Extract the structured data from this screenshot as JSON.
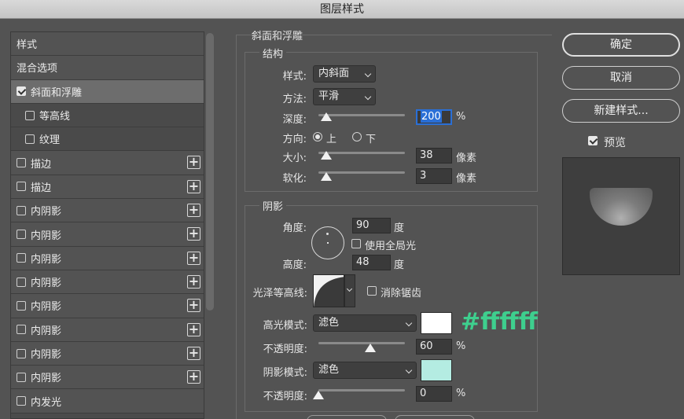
{
  "window": {
    "title": "图层样式"
  },
  "style_list": {
    "header": "样式",
    "blend": "混合选项",
    "items": [
      {
        "label": "斜面和浮雕",
        "checked": true,
        "selected": true,
        "sub": false,
        "plus": false
      },
      {
        "label": "等高线",
        "checked": false,
        "selected": false,
        "sub": true,
        "plus": false
      },
      {
        "label": "纹理",
        "checked": false,
        "selected": false,
        "sub": true,
        "plus": false
      },
      {
        "label": "描边",
        "checked": false,
        "selected": false,
        "sub": false,
        "plus": true
      },
      {
        "label": "描边",
        "checked": false,
        "selected": false,
        "sub": false,
        "plus": true
      },
      {
        "label": "内阴影",
        "checked": false,
        "selected": false,
        "sub": false,
        "plus": true
      },
      {
        "label": "内阴影",
        "checked": false,
        "selected": false,
        "sub": false,
        "plus": true
      },
      {
        "label": "内阴影",
        "checked": false,
        "selected": false,
        "sub": false,
        "plus": true
      },
      {
        "label": "内阴影",
        "checked": false,
        "selected": false,
        "sub": false,
        "plus": true
      },
      {
        "label": "内阴影",
        "checked": false,
        "selected": false,
        "sub": false,
        "plus": true
      },
      {
        "label": "内阴影",
        "checked": false,
        "selected": false,
        "sub": false,
        "plus": true
      },
      {
        "label": "内阴影",
        "checked": false,
        "selected": false,
        "sub": false,
        "plus": true
      },
      {
        "label": "内阴影",
        "checked": false,
        "selected": false,
        "sub": false,
        "plus": true
      },
      {
        "label": "内发光",
        "checked": false,
        "selected": false,
        "sub": false,
        "plus": false
      }
    ]
  },
  "bevel": {
    "title": "斜面和浮雕",
    "structure": {
      "title": "结构",
      "style_label": "样式:",
      "style_value": "内斜面",
      "method_label": "方法:",
      "method_value": "平滑",
      "depth_label": "深度:",
      "depth_value": "200",
      "depth_unit": "%",
      "depth_slider": 0.09,
      "direction_label": "方向:",
      "dir_up": "上",
      "dir_down": "下",
      "size_label": "大小:",
      "size_value": "38",
      "size_unit": "像素",
      "size_slider": 0.09,
      "soften_label": "软化:",
      "soften_value": "3",
      "soften_unit": "像素",
      "soften_slider": 0.09
    },
    "shading": {
      "title": "阴影",
      "angle_label": "角度:",
      "angle_value": "90",
      "angle_unit": "度",
      "global_light": "使用全局光",
      "altitude_label": "高度:",
      "altitude_value": "48",
      "altitude_unit": "度",
      "gloss_label": "光泽等高线:",
      "antialias": "消除锯齿",
      "highlight_label": "高光模式:",
      "highlight_mode": "滤色",
      "highlight_color": "#ffffff",
      "highlight_annotation": "#ffffff",
      "opacity1_label": "不透明度:",
      "opacity1_value": "60",
      "opacity1_unit": "%",
      "opacity1_slider": 0.6,
      "shadow_label": "阴影模式:",
      "shadow_mode": "滤色",
      "shadow_color": "#b4ece2",
      "opacity2_label": "不透明度:",
      "opacity2_value": "0",
      "opacity2_unit": "%",
      "opacity2_slider": 0.0
    }
  },
  "buttons": {
    "ok": "确定",
    "cancel": "取消",
    "new_style": "新建样式...",
    "preview": "预览"
  },
  "colors": {
    "annotation": "#3ecf8e",
    "accent": "#2a6fd6"
  }
}
